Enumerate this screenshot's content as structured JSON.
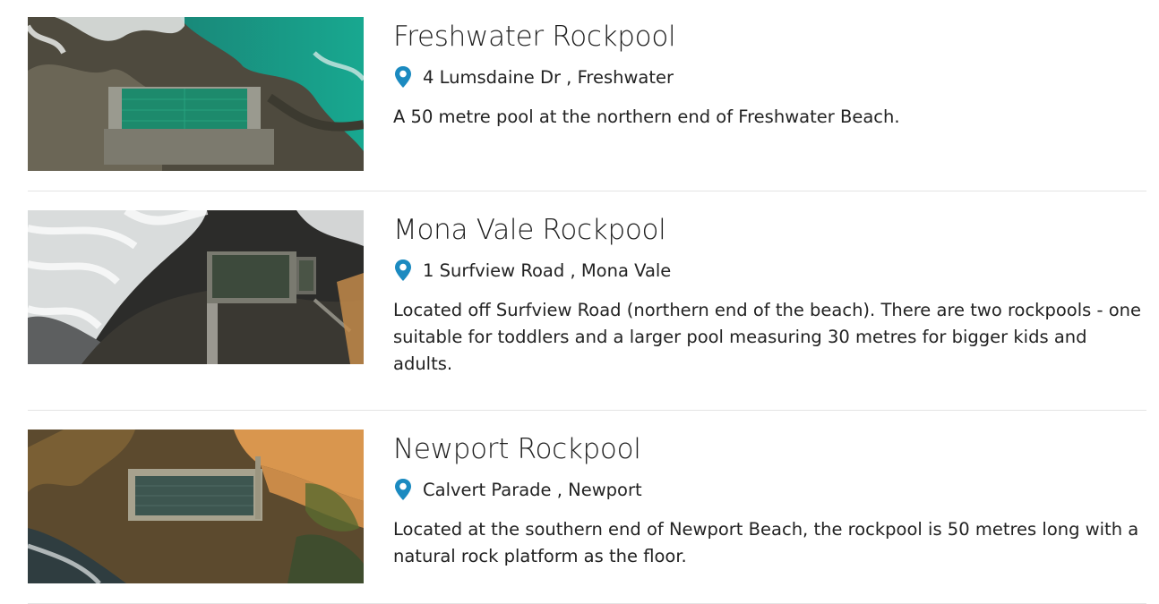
{
  "listings": [
    {
      "title": "Freshwater Rockpool",
      "address": "4 Lumsdaine Dr , Freshwater",
      "description": "A 50 metre pool at the northern end of Freshwater Beach.",
      "image_icon": "aerial-photo-freshwater-rockpool"
    },
    {
      "title": "Mona Vale Rockpool",
      "address": "1 Surfview Road , Mona Vale",
      "description": "Located off Surfview Road (northern end of the beach). There are two rockpools - one suitable for toddlers and a larger pool measuring 30 metres for bigger kids and adults.",
      "image_icon": "aerial-photo-mona-vale-rockpool"
    },
    {
      "title": "Newport Rockpool",
      "address": "Calvert Parade , Newport",
      "description": "Located at the southern end of Newport Beach, the rockpool is 50 metres long with a natural rock platform as the floor.",
      "image_icon": "aerial-photo-newport-rockpool"
    }
  ],
  "colors": {
    "pin": "#1b8ac0",
    "divider": "#e4e4e4",
    "text": "#222222"
  },
  "icons": {
    "location": "map-pin-icon"
  }
}
